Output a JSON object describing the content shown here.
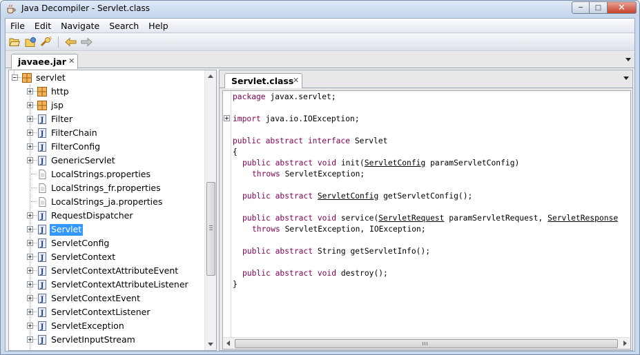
{
  "window": {
    "title": "Java Decompiler - Servlet.class"
  },
  "menu": [
    "File",
    "Edit",
    "Navigate",
    "Search",
    "Help"
  ],
  "toolbar": {
    "icons": [
      "open-folder-icon",
      "open-type-icon",
      "search-icon",
      "back-arrow-icon",
      "forward-arrow-icon"
    ]
  },
  "file_tab": {
    "label": "javaee.jar"
  },
  "tree": {
    "items": [
      {
        "label": "servlet",
        "kind": "package",
        "level": 0,
        "expander": "minus",
        "selected": false
      },
      {
        "label": "http",
        "kind": "package",
        "level": 1,
        "expander": "plus",
        "selected": false
      },
      {
        "label": "jsp",
        "kind": "package",
        "level": 1,
        "expander": "plus",
        "selected": false
      },
      {
        "label": "Filter",
        "kind": "class",
        "level": 1,
        "expander": "plus",
        "selected": false
      },
      {
        "label": "FilterChain",
        "kind": "class",
        "level": 1,
        "expander": "plus",
        "selected": false
      },
      {
        "label": "FilterConfig",
        "kind": "class",
        "level": 1,
        "expander": "plus",
        "selected": false
      },
      {
        "label": "GenericServlet",
        "kind": "class",
        "level": 1,
        "expander": "plus",
        "selected": false
      },
      {
        "label": "LocalStrings.properties",
        "kind": "file",
        "level": 1,
        "expander": "none",
        "selected": false
      },
      {
        "label": "LocalStrings_fr.properties",
        "kind": "file",
        "level": 1,
        "expander": "none",
        "selected": false
      },
      {
        "label": "LocalStrings_ja.properties",
        "kind": "file",
        "level": 1,
        "expander": "none",
        "selected": false
      },
      {
        "label": "RequestDispatcher",
        "kind": "class",
        "level": 1,
        "expander": "plus",
        "selected": false
      },
      {
        "label": "Servlet",
        "kind": "class",
        "level": 1,
        "expander": "plus",
        "selected": true
      },
      {
        "label": "ServletConfig",
        "kind": "class",
        "level": 1,
        "expander": "plus",
        "selected": false
      },
      {
        "label": "ServletContext",
        "kind": "class",
        "level": 1,
        "expander": "plus",
        "selected": false
      },
      {
        "label": "ServletContextAttributeEvent",
        "kind": "class",
        "level": 1,
        "expander": "plus",
        "selected": false
      },
      {
        "label": "ServletContextAttributeListener",
        "kind": "class",
        "level": 1,
        "expander": "plus",
        "selected": false
      },
      {
        "label": "ServletContextEvent",
        "kind": "class",
        "level": 1,
        "expander": "plus",
        "selected": false
      },
      {
        "label": "ServletContextListener",
        "kind": "class",
        "level": 1,
        "expander": "plus",
        "selected": false
      },
      {
        "label": "ServletException",
        "kind": "class",
        "level": 1,
        "expander": "plus",
        "selected": false
      },
      {
        "label": "ServletInputStream",
        "kind": "class",
        "level": 1,
        "expander": "plus",
        "selected": false
      }
    ]
  },
  "editor": {
    "tab": "Servlet.class",
    "lines": [
      {
        "row": 0,
        "indent": 0,
        "tokens": [
          {
            "t": "package",
            "k": "kw"
          },
          {
            "t": " javax.servlet;"
          }
        ]
      },
      {
        "row": 2,
        "indent": 0,
        "tokens": [
          {
            "t": "import",
            "k": "kw"
          },
          {
            "t": " java.io.IOException;"
          }
        ]
      },
      {
        "row": 4,
        "indent": 0,
        "tokens": [
          {
            "t": "public abstract interface",
            "k": "kw"
          },
          {
            "t": " Servlet"
          }
        ]
      },
      {
        "row": 5,
        "indent": 0,
        "tokens": [
          {
            "t": "{"
          }
        ]
      },
      {
        "row": 6,
        "indent": 1,
        "tokens": [
          {
            "t": "public abstract void",
            "k": "kw"
          },
          {
            "t": " init("
          },
          {
            "t": "ServletConfig",
            "k": "link"
          },
          {
            "t": " paramServletConfig)"
          }
        ]
      },
      {
        "row": 7,
        "indent": 2,
        "tokens": [
          {
            "t": "throws",
            "k": "kw"
          },
          {
            "t": " ServletException;"
          }
        ]
      },
      {
        "row": 9,
        "indent": 1,
        "tokens": [
          {
            "t": "public abstract",
            "k": "kw"
          },
          {
            "t": " "
          },
          {
            "t": "ServletConfig",
            "k": "link"
          },
          {
            "t": " getServletConfig();"
          }
        ]
      },
      {
        "row": 11,
        "indent": 1,
        "tokens": [
          {
            "t": "public abstract void",
            "k": "kw"
          },
          {
            "t": " service("
          },
          {
            "t": "ServletRequest",
            "k": "link"
          },
          {
            "t": " paramServletRequest, "
          },
          {
            "t": "ServletResponse",
            "k": "link"
          }
        ]
      },
      {
        "row": 12,
        "indent": 2,
        "tokens": [
          {
            "t": "throws",
            "k": "kw"
          },
          {
            "t": " ServletException, IOException;"
          }
        ]
      },
      {
        "row": 14,
        "indent": 1,
        "tokens": [
          {
            "t": "public abstract",
            "k": "kw"
          },
          {
            "t": " String getServletInfo();"
          }
        ]
      },
      {
        "row": 16,
        "indent": 1,
        "tokens": [
          {
            "t": "public abstract void",
            "k": "kw"
          },
          {
            "t": " destroy();"
          }
        ]
      },
      {
        "row": 17,
        "indent": 0,
        "tokens": [
          {
            "t": "}"
          }
        ]
      }
    ]
  },
  "colors": {
    "keyword": "#7f0055",
    "selection": "#3399ff",
    "window_frame": "#c9d9ee"
  }
}
